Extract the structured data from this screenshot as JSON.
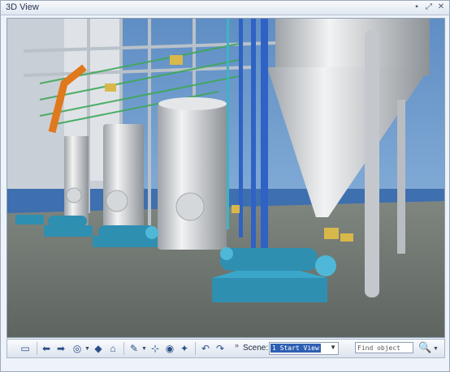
{
  "window": {
    "title": "3D View"
  },
  "toolbar": {
    "scene_label": "Scene:",
    "scene_value": "1 Start View",
    "find_placeholder": "Find object"
  }
}
